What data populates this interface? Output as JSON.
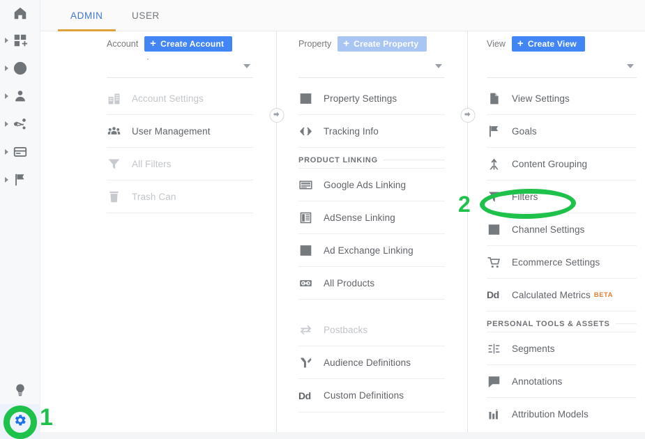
{
  "rail": {
    "top_items": [
      {
        "name": "home",
        "icon": "home-icon",
        "has_caret": false
      },
      {
        "name": "customization",
        "icon": "dashboard-add-icon",
        "has_caret": true
      },
      {
        "name": "realtime",
        "icon": "clock-icon",
        "has_caret": true
      },
      {
        "name": "audience",
        "icon": "person-icon",
        "has_caret": true
      },
      {
        "name": "acquisition",
        "icon": "share-network-icon",
        "has_caret": true
      },
      {
        "name": "behavior",
        "icon": "browser-card-icon",
        "has_caret": true
      },
      {
        "name": "conversions",
        "icon": "flag-icon",
        "has_caret": true
      }
    ],
    "bottom_items": [
      {
        "name": "discover",
        "icon": "lightbulb-icon"
      },
      {
        "name": "admin",
        "icon": "gear-icon"
      }
    ]
  },
  "tabs": [
    {
      "label": "ADMIN",
      "active": true
    },
    {
      "label": "USER",
      "active": false
    }
  ],
  "annotations": [
    {
      "label": "1",
      "target": "admin-gear-button",
      "shape": "circle",
      "color": "#1ec24a"
    },
    {
      "label": "2",
      "target": "view-filters-row",
      "shape": "ellipse",
      "color": "#1ec24a"
    }
  ],
  "columns": {
    "account": {
      "head_label": "Account",
      "create_label": "Create Account",
      "create_muted": false,
      "picker_value": "",
      "items": [
        {
          "label": "Account Settings",
          "icon": "building-icon",
          "dim": true
        },
        {
          "label": "User Management",
          "icon": "people-icon",
          "dim": false
        },
        {
          "label": "All Filters",
          "icon": "funnel-icon",
          "dim": true
        },
        {
          "label": "Trash Can",
          "icon": "trash-icon",
          "dim": true
        }
      ]
    },
    "property": {
      "head_label": "Property",
      "create_label": "Create Property",
      "create_muted": true,
      "picker_value": "",
      "items": [
        {
          "label": "Property Settings",
          "icon": "panel-icon",
          "dim": false
        },
        {
          "label": "Tracking Info",
          "icon": "code-brackets-icon",
          "dim": false
        },
        {
          "section": "PRODUCT LINKING"
        },
        {
          "label": "Google Ads Linking",
          "icon": "ads-banner-icon",
          "dim": false
        },
        {
          "label": "AdSense Linking",
          "icon": "adsense-list-icon",
          "dim": false
        },
        {
          "label": "Ad Exchange Linking",
          "icon": "ad-exchange-panel-icon",
          "dim": false
        },
        {
          "label": "All Products",
          "icon": "link-chain-icon",
          "dim": false
        },
        {
          "spacer": true
        },
        {
          "label": "Postbacks",
          "icon": "postback-arrows-icon",
          "dim": true
        },
        {
          "label": "Audience Definitions",
          "icon": "audience-branch-icon",
          "dim": false
        },
        {
          "label": "Custom Definitions",
          "icon": "dd-glyph-icon",
          "dim": false
        }
      ]
    },
    "view": {
      "head_label": "View",
      "create_label": "Create View",
      "create_muted": false,
      "picker_value": "",
      "items": [
        {
          "label": "View Settings",
          "icon": "document-icon",
          "dim": false
        },
        {
          "label": "Goals",
          "icon": "flag-icon",
          "dim": false
        },
        {
          "label": "Content Grouping",
          "icon": "merge-arrow-icon",
          "dim": false
        },
        {
          "label": "Filters",
          "icon": "funnel-icon",
          "dim": false,
          "highlighted": true
        },
        {
          "label": "Channel Settings",
          "icon": "channel-arrows-icon",
          "dim": false
        },
        {
          "label": "Ecommerce Settings",
          "icon": "shopping-cart-icon",
          "dim": false
        },
        {
          "label": "Calculated Metrics",
          "icon": "dd-glyph-icon",
          "dim": false,
          "badge": "BETA"
        },
        {
          "section": "PERSONAL TOOLS & ASSETS"
        },
        {
          "label": "Segments",
          "icon": "segments-icon",
          "dim": false
        },
        {
          "label": "Annotations",
          "icon": "comment-icon",
          "dim": false
        },
        {
          "label": "Attribution Models",
          "icon": "bar-chart-icon",
          "dim": false
        }
      ]
    }
  },
  "dividers": [
    {
      "name": "account-property-divider",
      "button": "copy-right-arrow-button"
    },
    {
      "name": "property-view-divider",
      "button": "copy-right-arrow-button"
    }
  ]
}
